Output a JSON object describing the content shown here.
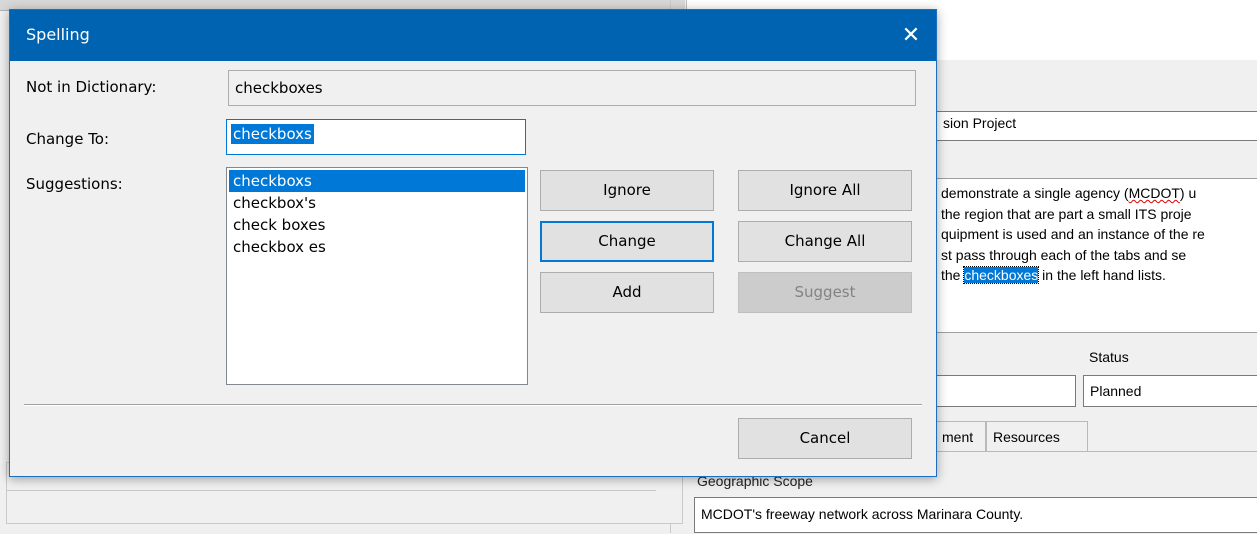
{
  "background": {
    "project_name_partial": "sion Project",
    "description_lines": [
      {
        "pre": "demonstrate a single agency (",
        "squig": "MCDOT",
        "post": ") u"
      },
      {
        "pre": "the region that are part a small ITS proje"
      },
      {
        "pre": "quipment is used and an instance of the re"
      },
      {
        "pre": "st pass through each of the tabs and se"
      },
      {
        "pre": "the ",
        "hl": "checkboxes",
        "post": " in the left hand lists."
      }
    ],
    "status_label": "Status",
    "status_value": "Planned",
    "tab_partial": "ment",
    "tab_resources": "Resources",
    "geo_scope_label": "Geographic Scope",
    "geo_scope_value": "MCDOT's freeway network across Marinara County."
  },
  "dialog": {
    "title": "Spelling",
    "close_glyph": "✕",
    "not_in_dictionary_label": "Not in Dictionary:",
    "not_in_dictionary_value": "checkboxes",
    "change_to_label": "Change To:",
    "change_to_value": "checkboxs",
    "suggestions_label": "Suggestions:",
    "suggestions": [
      "checkboxs",
      "checkbox's",
      "check boxes",
      "checkbox es"
    ],
    "selected_suggestion_index": 0,
    "buttons": {
      "ignore": "Ignore",
      "ignore_all": "Ignore All",
      "change": "Change",
      "change_all": "Change All",
      "add": "Add",
      "suggest": "Suggest",
      "cancel": "Cancel"
    }
  }
}
